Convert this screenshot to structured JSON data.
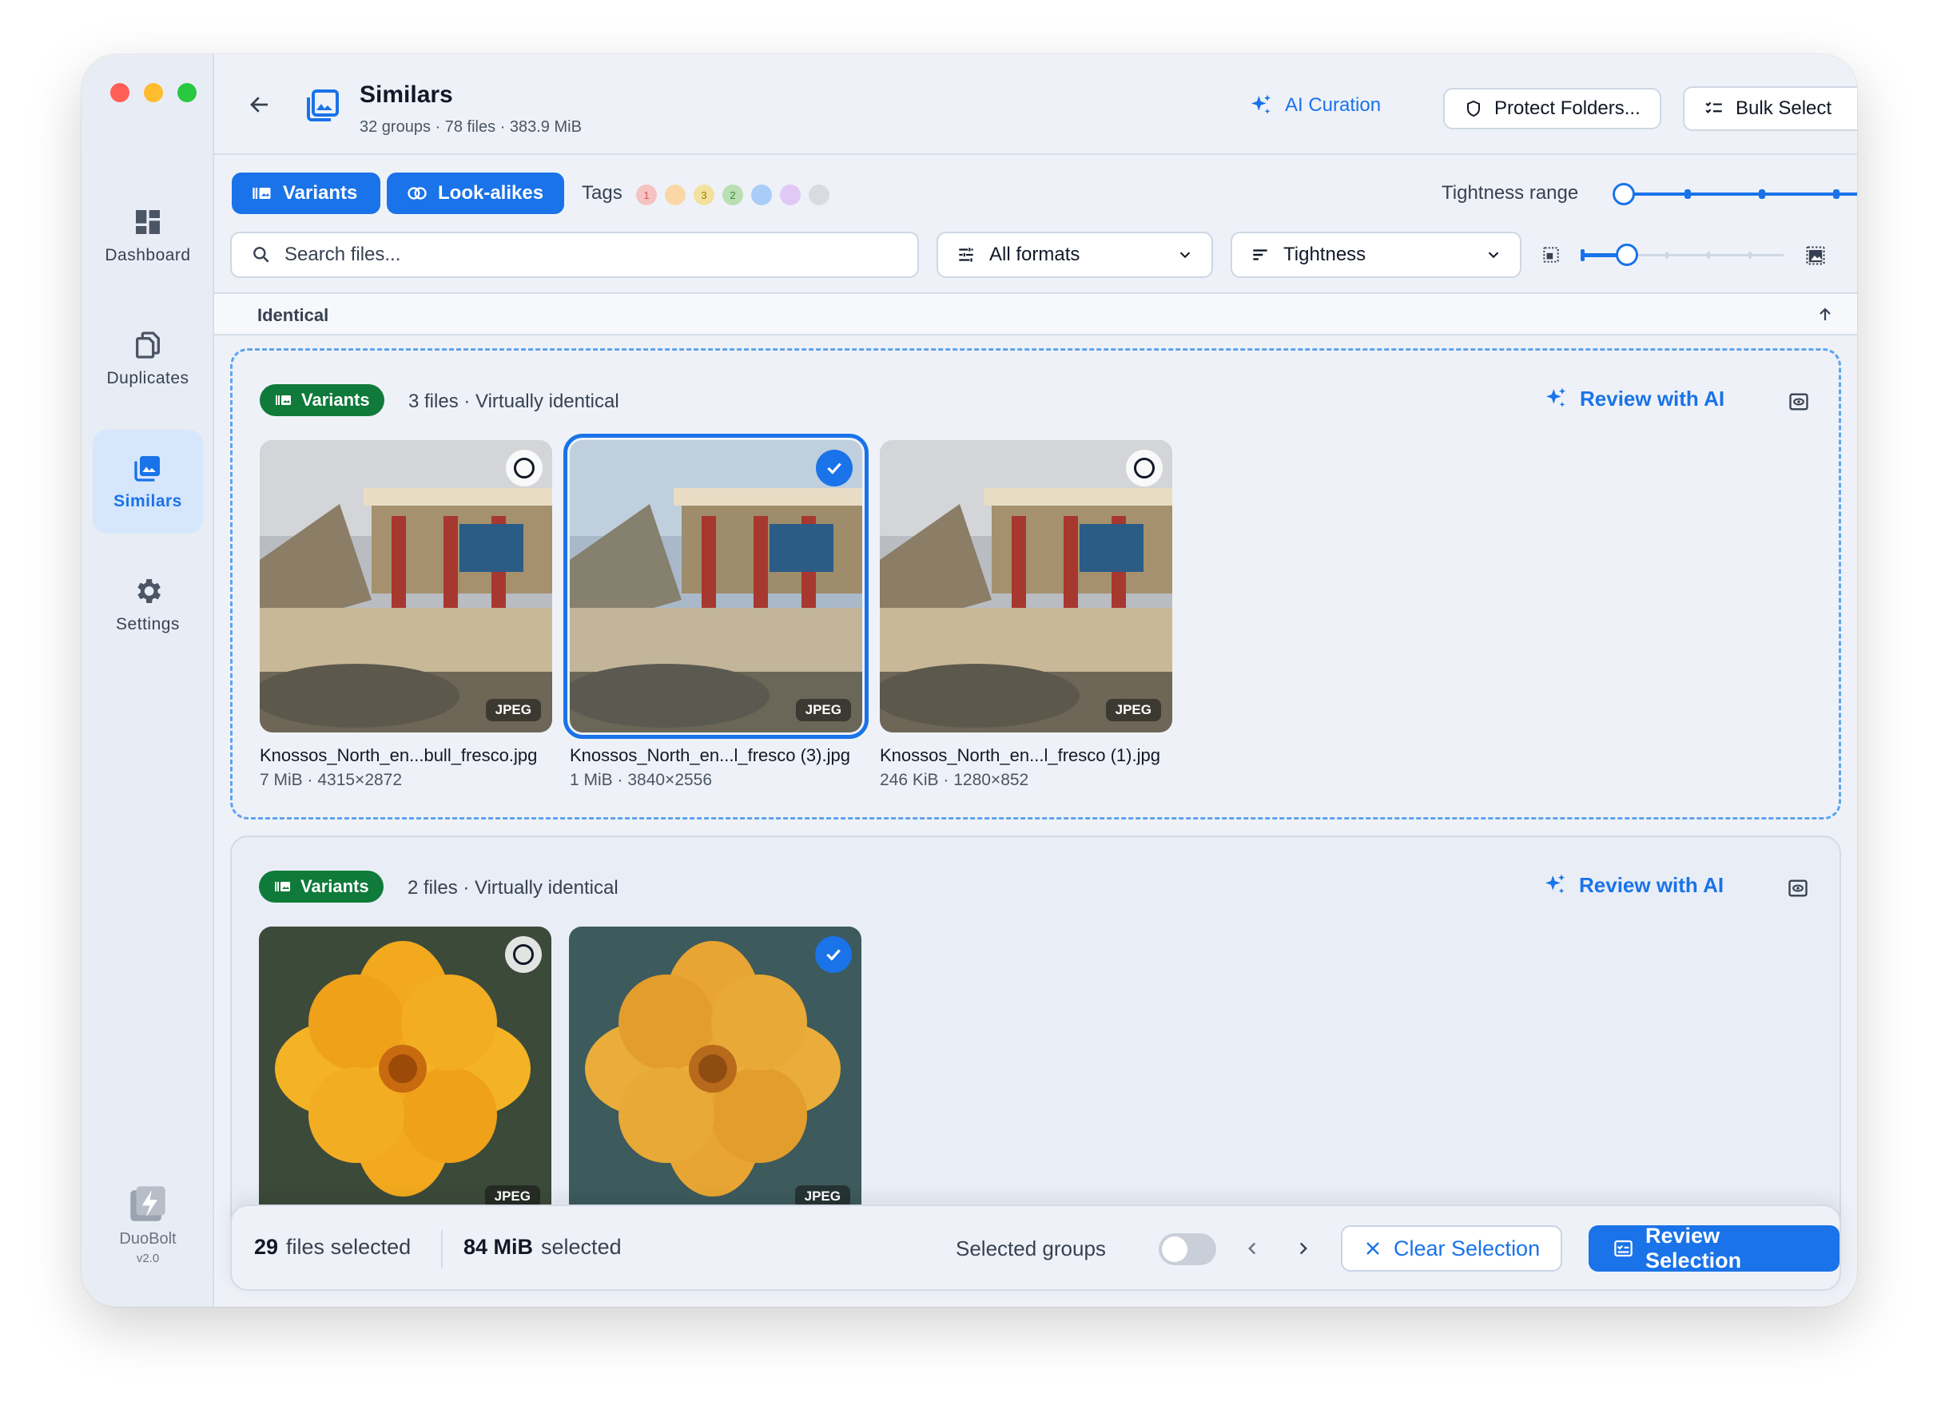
{
  "sidebar": {
    "items": [
      {
        "label": "Dashboard",
        "icon": "dashboard-icon"
      },
      {
        "label": "Duplicates",
        "icon": "duplicates-icon"
      },
      {
        "label": "Similars",
        "icon": "similars-icon",
        "active": true
      },
      {
        "label": "Settings",
        "icon": "gear-icon"
      }
    ],
    "brand": {
      "name": "DuoBolt",
      "version": "v2.0"
    }
  },
  "header": {
    "title": "Similars",
    "subtitle": "32 groups · 78 files · 383.9 MiB",
    "ai_curation": "AI Curation",
    "protect_folders": "Protect Folders...",
    "bulk_select": "Bulk Select"
  },
  "toolbar": {
    "tab_variants": "Variants",
    "tab_lookalikes": "Look-alikes",
    "tags_label": "Tags",
    "tags": [
      {
        "label": "1",
        "color": "#f6c3c3",
        "text": "#d9534f"
      },
      {
        "label": "",
        "color": "#fad7a6",
        "text": "#000"
      },
      {
        "label": "3",
        "color": "#f3e1a0",
        "text": "#a17a00"
      },
      {
        "label": "2",
        "color": "#b9dfb2",
        "text": "#3f8a36"
      },
      {
        "label": "",
        "color": "#a9cdf7",
        "text": "#000"
      },
      {
        "label": "",
        "color": "#e0c9f5",
        "text": "#000"
      },
      {
        "label": "",
        "color": "#d9dbe0",
        "text": "#000"
      }
    ],
    "tightness_range_label": "Tightness range",
    "search_placeholder": "Search files...",
    "format_filter": "All formats",
    "sort_by": "Tightness"
  },
  "section": {
    "title": "Identical"
  },
  "groups": [
    {
      "badge": "Variants",
      "info": "3 files · Virtually identical",
      "review": "Review with AI",
      "files": [
        {
          "name": "Knossos_North_en...bull_fresco.jpg",
          "meta": "7 MiB · 4315×2872",
          "format": "JPEG",
          "selected": false
        },
        {
          "name": "Knossos_North_en...l_fresco (3).jpg",
          "meta": "1 MiB · 3840×2556",
          "format": "JPEG",
          "selected": true
        },
        {
          "name": "Knossos_North_en...l_fresco (1).jpg",
          "meta": "246 KiB · 1280×852",
          "format": "JPEG",
          "selected": false
        }
      ]
    },
    {
      "badge": "Variants",
      "info": "2 files · Virtually identical",
      "review": "Review with AI",
      "files": [
        {
          "format": "JPEG",
          "selected": false
        },
        {
          "format": "JPEG",
          "selected": true
        }
      ]
    }
  ],
  "footer": {
    "files_count": "29",
    "files_label": "files selected",
    "size": "84 MiB",
    "size_label": "selected",
    "selected_groups_label": "Selected groups",
    "clear": "Clear Selection",
    "review": "Review Selection"
  },
  "colors": {
    "accent": "#1a73e8",
    "badge_green": "#0f7a3a"
  }
}
